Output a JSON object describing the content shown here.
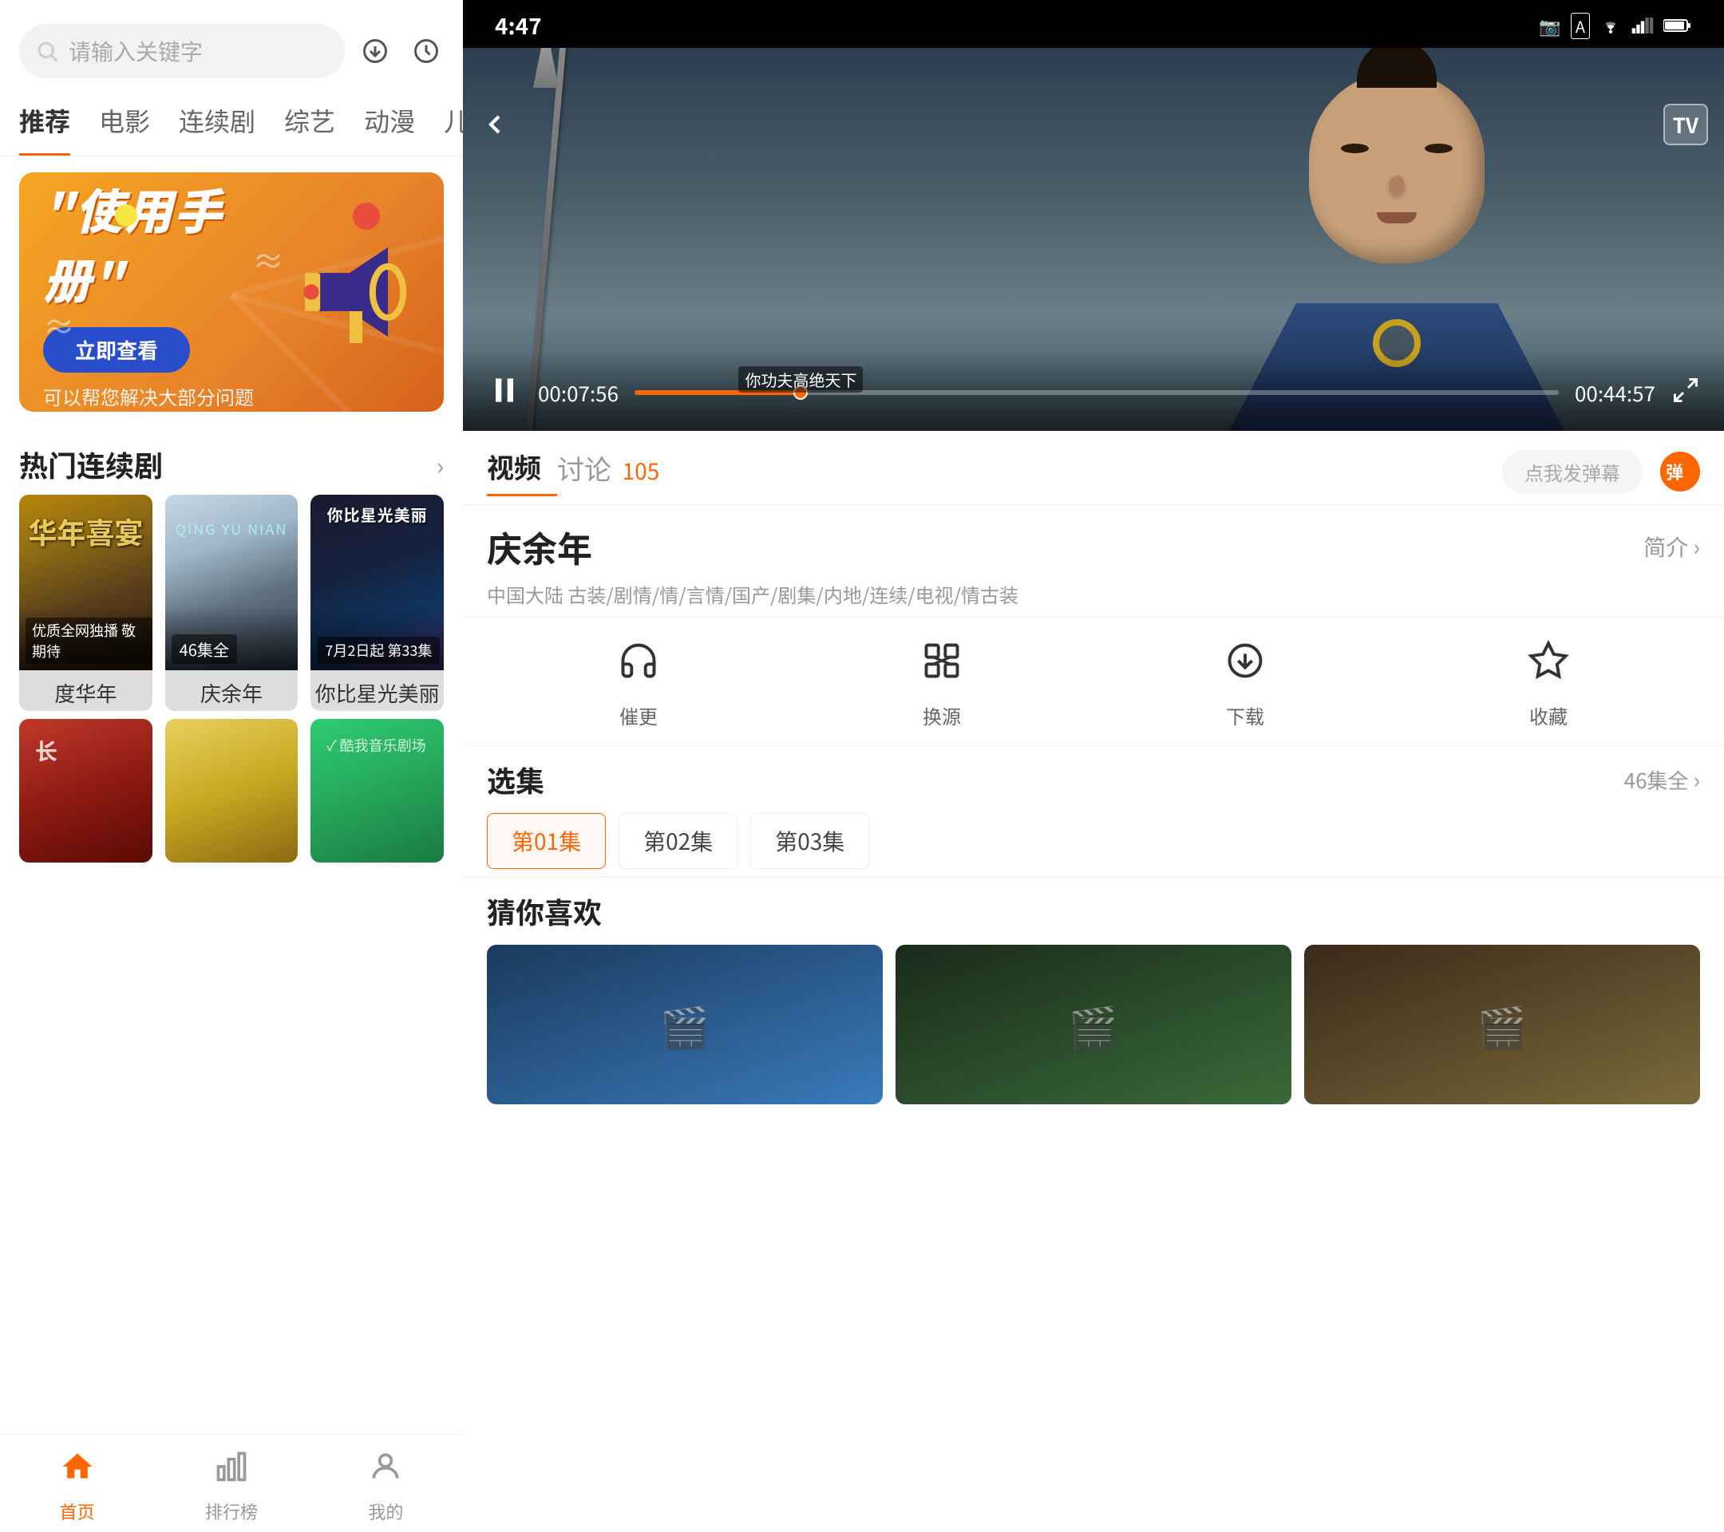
{
  "left": {
    "search": {
      "placeholder": "请输入关键字"
    },
    "nav_tabs": [
      {
        "label": "推荐",
        "active": true
      },
      {
        "label": "电影",
        "active": false
      },
      {
        "label": "连续剧",
        "active": false
      },
      {
        "label": "综艺",
        "active": false
      },
      {
        "label": "动漫",
        "active": false
      },
      {
        "label": "儿童",
        "active": false
      }
    ],
    "banner": {
      "title": "使用手册",
      "btn_label": "立即查看",
      "subtitle": "可以帮您解决大部分问题"
    },
    "hot_section": {
      "title": "热门连续剧"
    },
    "drama_cards": [
      {
        "title": "度华年",
        "badge": "优质全网独播 敬期待"
      },
      {
        "title": "庆余年",
        "badge": "46集全"
      },
      {
        "title": "你比星光美丽",
        "badge2": "7月2日起 第33集"
      }
    ],
    "bottom_nav": [
      {
        "label": "首页",
        "active": true,
        "icon": "🏠"
      },
      {
        "label": "排行榜",
        "active": false,
        "icon": "📊"
      },
      {
        "label": "我的",
        "active": false,
        "icon": "😊"
      }
    ]
  },
  "right": {
    "status_bar": {
      "time": "4:47",
      "icons": [
        "📷",
        "A",
        "▼",
        "📶",
        "🔋"
      ]
    },
    "video": {
      "back_label": "‹",
      "tv_label": "TV",
      "current_time": "00:07:56",
      "total_time": "00:44:57",
      "subtitle_text": "你功夫高绝天下",
      "progress_percent": 18
    },
    "tabs": [
      {
        "label": "视频",
        "active": true
      },
      {
        "label": "讨论",
        "active": false
      }
    ],
    "discuss_count": "105",
    "danmu_placeholder": "点我发弹幕",
    "danmu_btn_label": "弹",
    "drama": {
      "name": "庆余年",
      "info_link": "简介 ›",
      "tags": "中国大陆  古装/剧情/情/言情/国产/剧集/内地/连续/电视/情古装"
    },
    "action_buttons": [
      {
        "icon": "🎧",
        "label": "催更"
      },
      {
        "icon": "🔄",
        "label": "换源"
      },
      {
        "icon": "⬇",
        "label": "下载"
      },
      {
        "icon": "⭐",
        "label": "收藏"
      }
    ],
    "episode_section": {
      "title": "选集",
      "count": "46集全",
      "episodes": [
        "第01集",
        "第02集",
        "第03集"
      ]
    },
    "recommend": {
      "title": "猜你喜欢"
    }
  }
}
